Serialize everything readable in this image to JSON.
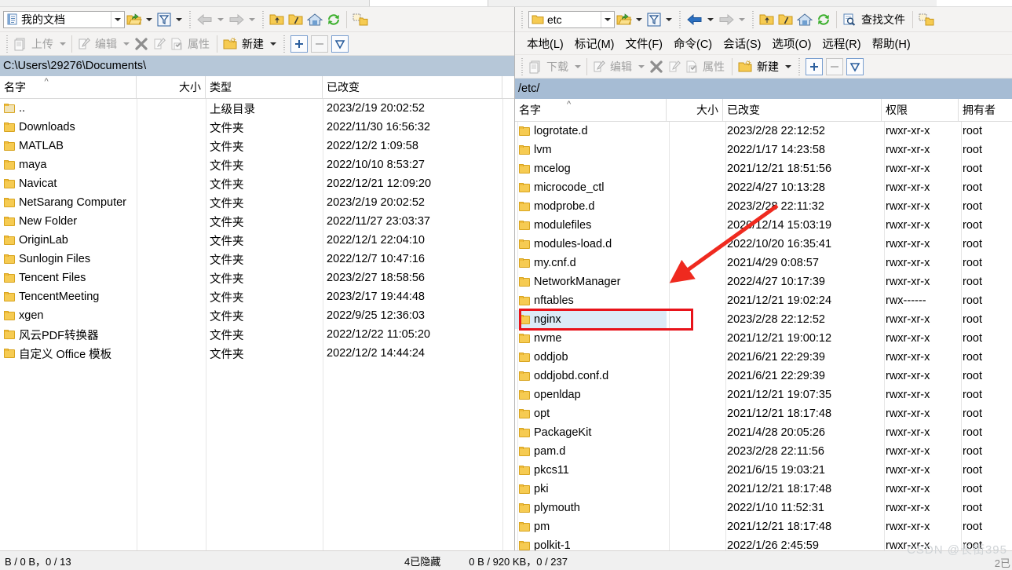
{
  "window": {
    "watermark": "CSDN @长街395",
    "watermark_corner": "2已"
  },
  "left_pane": {
    "drive_combo": {
      "value": "我的文档",
      "icon": "document-icon"
    },
    "toolbar": {
      "open_dir_label": "open-directory-icon",
      "filter_label": "filter-icon",
      "back_label": "back-icon",
      "forward_label": "forward-icon",
      "parent_label": "parent-directory-icon",
      "root_label": "root-directory-icon",
      "home_label": "home-icon",
      "refresh_label": "refresh-icon",
      "bookmark_label": "bookmark-icon"
    },
    "toolbar2": {
      "upload": "上传",
      "edit": "编辑",
      "delete": "delete-icon",
      "rename": "rename-icon",
      "properties": "属性",
      "new": "新建",
      "add": "+",
      "remove": "−",
      "select": "select-icon"
    },
    "address": "C:\\Users\\29276\\Documents\\",
    "columns": [
      {
        "key": "name",
        "label": "名字",
        "align": "left"
      },
      {
        "key": "size",
        "label": "大小",
        "align": "right"
      },
      {
        "key": "type",
        "label": "类型",
        "align": "left"
      },
      {
        "key": "changed",
        "label": "已改变",
        "align": "left"
      }
    ],
    "rows": [
      {
        "name": "..",
        "size": "",
        "type": "上级目录",
        "changed": "2023/2/19  20:02:52",
        "parent": true
      },
      {
        "name": "Downloads",
        "size": "",
        "type": "文件夹",
        "changed": "2022/11/30  16:56:32"
      },
      {
        "name": "MATLAB",
        "size": "",
        "type": "文件夹",
        "changed": "2022/12/2  1:09:58"
      },
      {
        "name": "maya",
        "size": "",
        "type": "文件夹",
        "changed": "2022/10/10  8:53:27"
      },
      {
        "name": "Navicat",
        "size": "",
        "type": "文件夹",
        "changed": "2022/12/21  12:09:20"
      },
      {
        "name": "NetSarang Computer",
        "size": "",
        "type": "文件夹",
        "changed": "2023/2/19  20:02:52"
      },
      {
        "name": "New Folder",
        "size": "",
        "type": "文件夹",
        "changed": "2022/11/27  23:03:37"
      },
      {
        "name": "OriginLab",
        "size": "",
        "type": "文件夹",
        "changed": "2022/12/1  22:04:10"
      },
      {
        "name": "Sunlogin Files",
        "size": "",
        "type": "文件夹",
        "changed": "2022/12/7  10:47:16"
      },
      {
        "name": "Tencent Files",
        "size": "",
        "type": "文件夹",
        "changed": "2023/2/27  18:58:56"
      },
      {
        "name": "TencentMeeting",
        "size": "",
        "type": "文件夹",
        "changed": "2023/2/17  19:44:48"
      },
      {
        "name": "xgen",
        "size": "",
        "type": "文件夹",
        "changed": "2022/9/25  12:36:03"
      },
      {
        "name": "风云PDF转换器",
        "size": "",
        "type": "文件夹",
        "changed": "2022/12/22  11:05:20"
      },
      {
        "name": "自定义 Office 模板",
        "size": "",
        "type": "文件夹",
        "changed": "2022/12/2  14:44:24"
      }
    ],
    "status": {
      "left": "B / 0 B，0 / 13",
      "hidden": "4已隐藏"
    }
  },
  "right_pane": {
    "dir_combo": {
      "value": "etc",
      "icon": "folder-icon"
    },
    "find_files_label": "查找文件",
    "menu": [
      "本地(L)",
      "标记(M)",
      "文件(F)",
      "命令(C)",
      "会话(S)",
      "选项(O)",
      "远程(R)",
      "帮助(H)"
    ],
    "toolbar2": {
      "download": "下载",
      "edit": "编辑",
      "delete": "delete-icon",
      "rename": "rename-icon",
      "properties": "属性",
      "new": "新建",
      "add": "+",
      "remove": "−",
      "select": "select-icon"
    },
    "address": "/etc/",
    "columns": [
      {
        "key": "name",
        "label": "名字",
        "align": "left"
      },
      {
        "key": "size",
        "label": "大小",
        "align": "right"
      },
      {
        "key": "changed",
        "label": "已改变",
        "align": "left"
      },
      {
        "key": "rights",
        "label": "权限",
        "align": "left"
      },
      {
        "key": "owner",
        "label": "拥有者",
        "align": "left"
      }
    ],
    "rows": [
      {
        "name": "logrotate.d",
        "size": "",
        "changed": "2023/2/28 22:12:52",
        "rights": "rwxr-xr-x",
        "owner": "root"
      },
      {
        "name": "lvm",
        "size": "",
        "changed": "2022/1/17 14:23:58",
        "rights": "rwxr-xr-x",
        "owner": "root"
      },
      {
        "name": "mcelog",
        "size": "",
        "changed": "2021/12/21 18:51:56",
        "rights": "rwxr-xr-x",
        "owner": "root"
      },
      {
        "name": "microcode_ctl",
        "size": "",
        "changed": "2022/4/27 10:13:28",
        "rights": "rwxr-xr-x",
        "owner": "root"
      },
      {
        "name": "modprobe.d",
        "size": "",
        "changed": "2023/2/28 22:11:32",
        "rights": "rwxr-xr-x",
        "owner": "root"
      },
      {
        "name": "modulefiles",
        "size": "",
        "changed": "2020/12/14 15:03:19",
        "rights": "rwxr-xr-x",
        "owner": "root"
      },
      {
        "name": "modules-load.d",
        "size": "",
        "changed": "2022/10/20 16:35:41",
        "rights": "rwxr-xr-x",
        "owner": "root"
      },
      {
        "name": "my.cnf.d",
        "size": "",
        "changed": "2021/4/29 0:08:57",
        "rights": "rwxr-xr-x",
        "owner": "root"
      },
      {
        "name": "NetworkManager",
        "size": "",
        "changed": "2022/4/27 10:17:39",
        "rights": "rwxr-xr-x",
        "owner": "root"
      },
      {
        "name": "nftables",
        "size": "",
        "changed": "2021/12/21 19:02:24",
        "rights": "rwx------",
        "owner": "root"
      },
      {
        "name": "nginx",
        "size": "",
        "changed": "2023/2/28 22:12:52",
        "rights": "rwxr-xr-x",
        "owner": "root",
        "selected": true
      },
      {
        "name": "nvme",
        "size": "",
        "changed": "2021/12/21 19:00:12",
        "rights": "rwxr-xr-x",
        "owner": "root"
      },
      {
        "name": "oddjob",
        "size": "",
        "changed": "2021/6/21 22:29:39",
        "rights": "rwxr-xr-x",
        "owner": "root"
      },
      {
        "name": "oddjobd.conf.d",
        "size": "",
        "changed": "2021/6/21 22:29:39",
        "rights": "rwxr-xr-x",
        "owner": "root"
      },
      {
        "name": "openldap",
        "size": "",
        "changed": "2021/12/21 19:07:35",
        "rights": "rwxr-xr-x",
        "owner": "root"
      },
      {
        "name": "opt",
        "size": "",
        "changed": "2021/12/21 18:17:48",
        "rights": "rwxr-xr-x",
        "owner": "root"
      },
      {
        "name": "PackageKit",
        "size": "",
        "changed": "2021/4/28 20:05:26",
        "rights": "rwxr-xr-x",
        "owner": "root"
      },
      {
        "name": "pam.d",
        "size": "",
        "changed": "2023/2/28 22:11:56",
        "rights": "rwxr-xr-x",
        "owner": "root"
      },
      {
        "name": "pkcs11",
        "size": "",
        "changed": "2021/6/15 19:03:21",
        "rights": "rwxr-xr-x",
        "owner": "root"
      },
      {
        "name": "pki",
        "size": "",
        "changed": "2021/12/21 18:17:48",
        "rights": "rwxr-xr-x",
        "owner": "root"
      },
      {
        "name": "plymouth",
        "size": "",
        "changed": "2022/1/10 11:52:31",
        "rights": "rwxr-xr-x",
        "owner": "root"
      },
      {
        "name": "pm",
        "size": "",
        "changed": "2021/12/21 18:17:48",
        "rights": "rwxr-xr-x",
        "owner": "root"
      },
      {
        "name": "polkit-1",
        "size": "",
        "changed": "2022/1/26 2:45:59",
        "rights": "rwxr-xr-x",
        "owner": "root"
      }
    ],
    "status": {
      "left": "0 B / 920 KB，0 / 237"
    }
  },
  "annotation": {
    "highlight_color": "#e8131a",
    "arrow_color": "#ef2a1f",
    "target": "nginx"
  }
}
